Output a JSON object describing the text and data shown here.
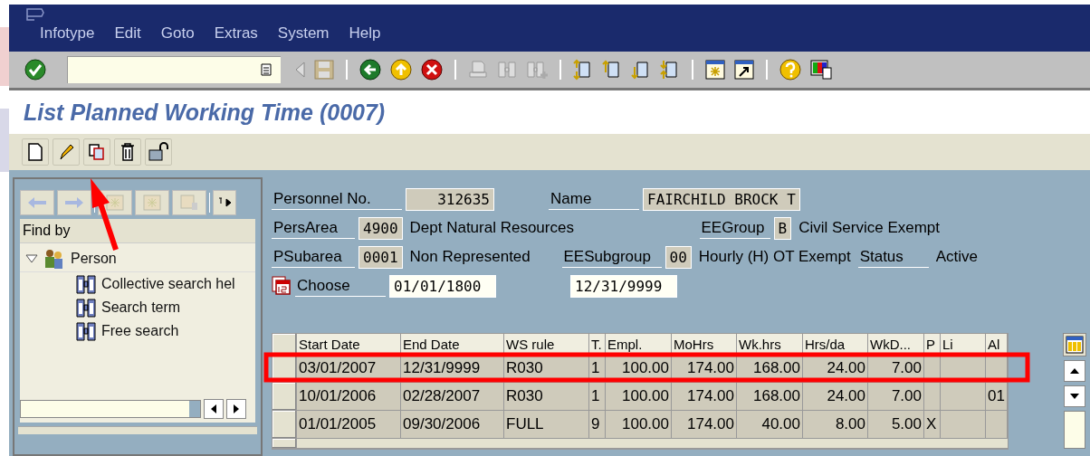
{
  "menu": [
    {
      "label": "Infotype"
    },
    {
      "label": "Edit"
    },
    {
      "label": "Goto"
    },
    {
      "label": "Extras"
    },
    {
      "label": "System"
    },
    {
      "label": "Help"
    }
  ],
  "title": "List Planned Working Time (0007)",
  "find_by": {
    "title": "Find by",
    "tree": [
      {
        "label": "Person",
        "expanded": true,
        "children": [
          {
            "label": "Collective search hel"
          },
          {
            "label": "Search term"
          },
          {
            "label": "Free search"
          }
        ]
      }
    ]
  },
  "header": {
    "personnel_label": "Personnel No.",
    "personnel_no": "312635",
    "name_label": "Name",
    "name": "FAIRCHILD BROCK T",
    "persarea_label": "PersArea",
    "persarea": "4900",
    "persarea_text": "Dept Natural Resources",
    "eegroup_label": "EEGroup",
    "eegroup": "B",
    "eegroup_text": "Civil Service Exempt",
    "psubarea_label": "PSubarea",
    "psubarea": "0001",
    "psubarea_text": "Non Represented",
    "eesubgroup_label": "EESubgroup",
    "eesubgroup": "00",
    "eesubgroup_text": "Hourly (H) OT Exempt",
    "status_label": "Status",
    "status": "Active",
    "choose_label": "Choose",
    "from": "01/01/1800",
    "to": "12/31/9999"
  },
  "table": {
    "columns": [
      "Start Date",
      "End Date",
      "WS rule",
      "T.",
      "Empl.",
      "MoHrs",
      "Wk.hrs",
      "Hrs/da",
      "WkD...",
      "P",
      "Li",
      "Al"
    ],
    "rows": [
      {
        "cells": [
          "03/01/2007",
          "12/31/9999",
          "R030",
          "1",
          "100.00",
          "174.00",
          "168.00",
          "24.00",
          "7.00",
          "",
          "",
          ""
        ]
      },
      {
        "cells": [
          "10/01/2006",
          "02/28/2007",
          "R030",
          "1",
          "100.00",
          "174.00",
          "168.00",
          "24.00",
          "7.00",
          "",
          "",
          "01"
        ]
      },
      {
        "cells": [
          "01/01/2005",
          "09/30/2006",
          "FULL",
          "9",
          "100.00",
          "174.00",
          "40.00",
          "8.00",
          "5.00",
          "X",
          "",
          ""
        ]
      }
    ]
  }
}
